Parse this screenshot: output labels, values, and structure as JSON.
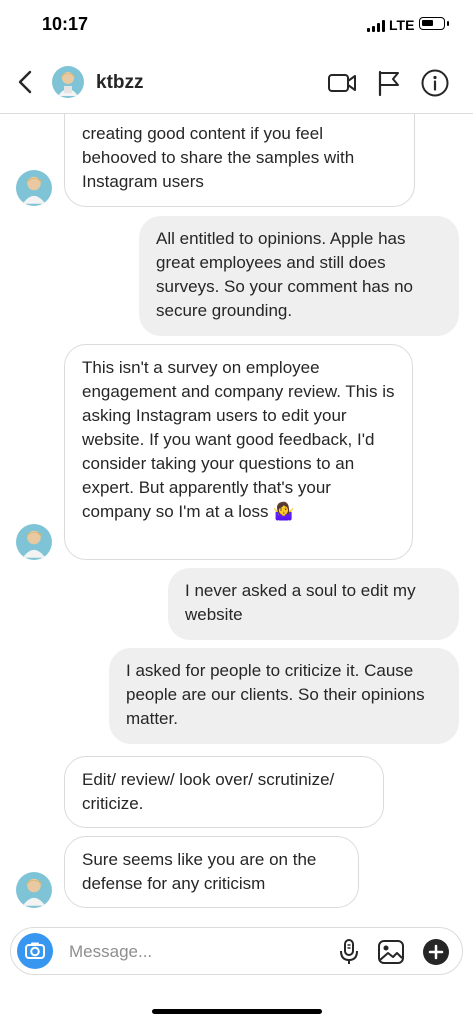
{
  "status_bar": {
    "time": "10:17",
    "network": "LTE"
  },
  "header": {
    "username": "ktbzz",
    "icons": [
      "back-chevron-icon",
      "video-camera-icon",
      "flag-icon",
      "info-icon"
    ]
  },
  "messages": [
    {
      "from": "them",
      "text": "creating good content if you feel behooved to share the samples with Instagram users"
    },
    {
      "from": "me",
      "text": "All entitled to opinions. Apple has great employees and still does surveys. So your comment has no secure grounding."
    },
    {
      "from": "them",
      "text": "This isn't a survey on employee engagement and company review. This is asking Instagram users to edit your website. If you want good feedback, I'd consider taking your questions to an expert. But apparently that's your company so I'm at a loss 🤷‍♀️"
    },
    {
      "from": "me",
      "text": "I never asked a soul to edit my website"
    },
    {
      "from": "me",
      "text": "I asked for people to criticize it. Cause people are our clients. So their opinions matter."
    },
    {
      "from": "them",
      "text": "Edit/ review/ look over/ scrutinize/ criticize."
    },
    {
      "from": "them",
      "text": "Sure seems like you are on the defense for any criticism"
    }
  ],
  "composer": {
    "placeholder": "Message...",
    "icons": [
      "camera-icon",
      "microphone-icon",
      "gallery-icon",
      "add-icon"
    ]
  },
  "colors": {
    "accent": "#3797f0",
    "my_bubble": "#efefef",
    "their_bubble_border": "#dbdbdb"
  }
}
